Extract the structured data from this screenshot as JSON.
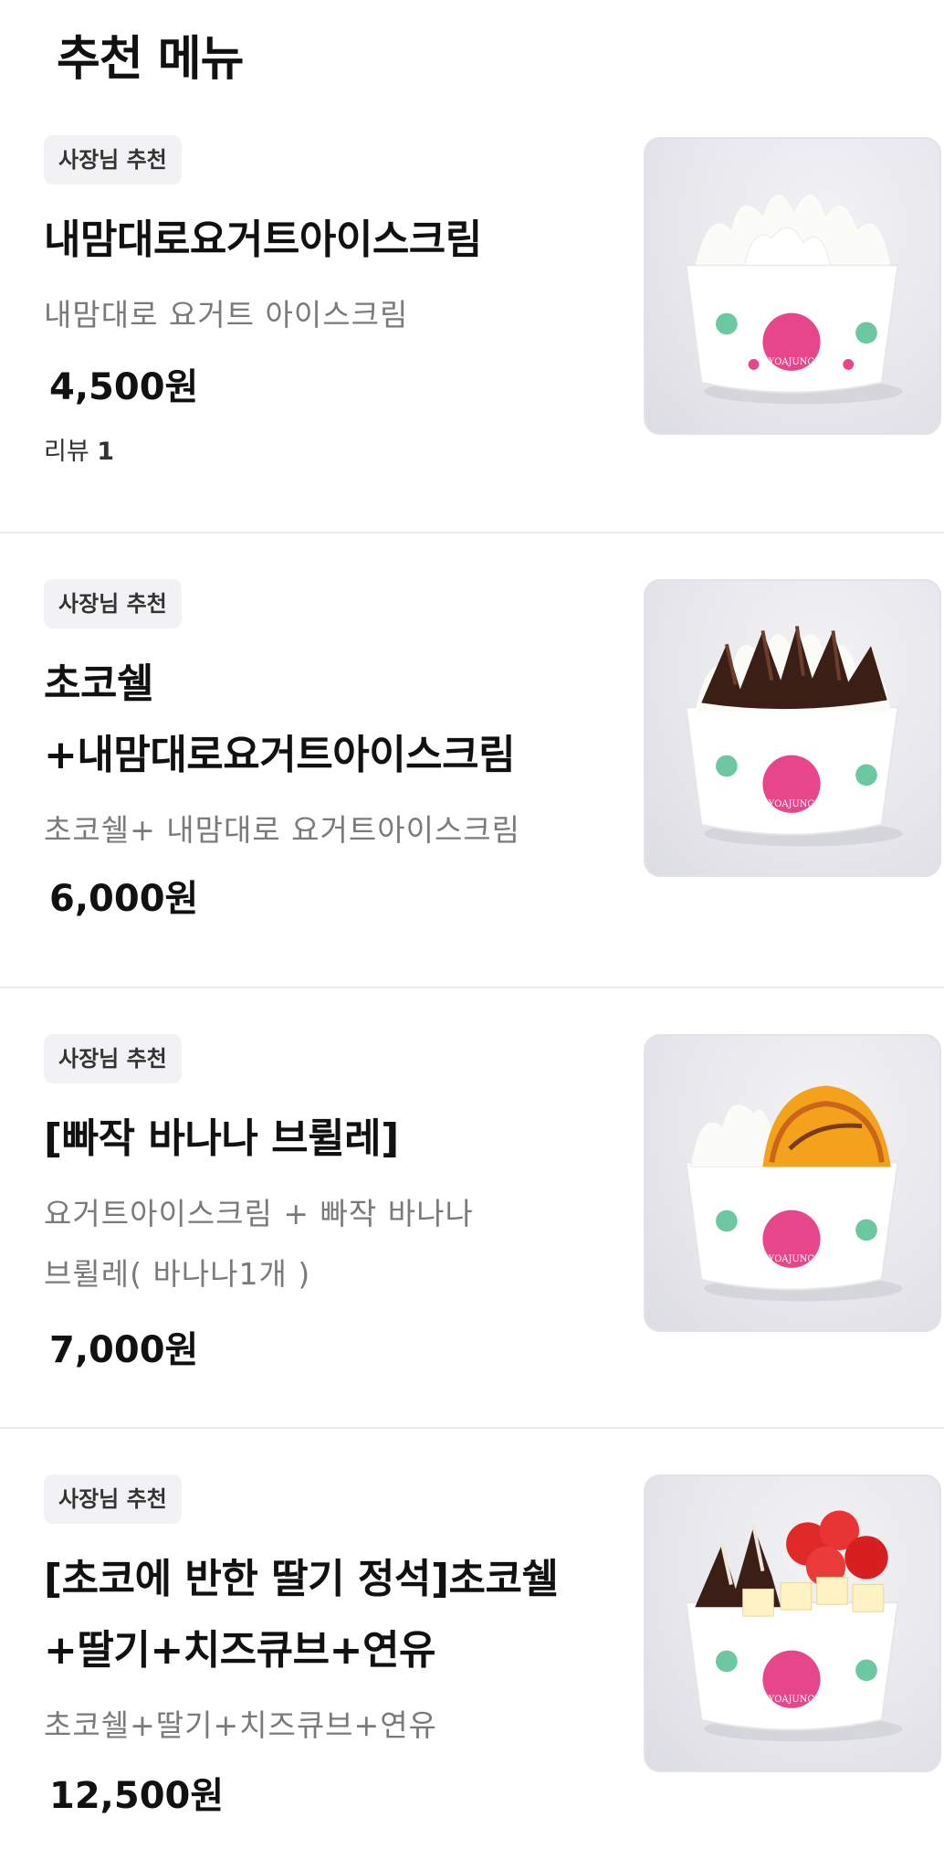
{
  "section": {
    "title": "추천 메뉴"
  },
  "items": [
    {
      "badge": "사장님 추천",
      "name": "내맘대로요거트아이스크림",
      "description": [
        "내맘대로 요거트 아이스크림"
      ],
      "price": "4,500원",
      "review_label": "리뷰",
      "review_count": "1",
      "image_icon": "yogurt-cup-icon"
    },
    {
      "badge": "사장님 추천",
      "name": "초코쉘+내맘대로요거트아이스크림",
      "description": [
        "초코쉘+ 내맘대로 요거트아이스크림"
      ],
      "price": "6,000원",
      "image_icon": "choco-yogurt-cup-icon"
    },
    {
      "badge": "사장님 추천",
      "name": "[빠작 바나나 브륄레]",
      "description": [
        "요거트아이스크림  + 빠작 바나나",
        "브륄레( 바나나1개 )"
      ],
      "price": "7,000원",
      "image_icon": "banana-brulee-cup-icon"
    },
    {
      "badge": "사장님 추천",
      "name": "[초코에 반한 딸기 정석]초코쉘+딸기+치즈큐브+연유",
      "description": [
        "초코쉘+딸기+치즈큐브+연유"
      ],
      "price": "12,500원",
      "image_icon": "strawberry-choco-cup-icon"
    }
  ],
  "cup_label": "YOAJUNG",
  "colors": {
    "badge_bg": "#f2f2f4",
    "description": "#7a7a7a",
    "divider": "#ececec",
    "cup_logo": "#e8468a"
  }
}
